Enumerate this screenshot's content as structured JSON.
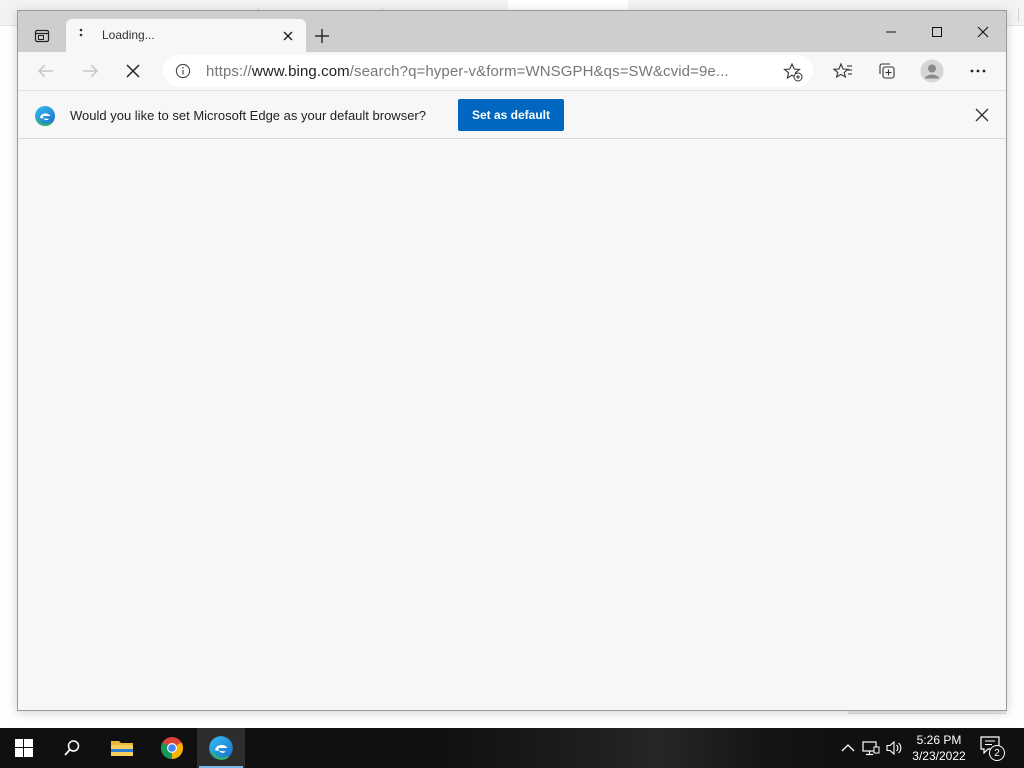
{
  "browser": {
    "tab": {
      "title": "Loading...",
      "state": "loading"
    },
    "address": {
      "scheme": "https://",
      "host": "www.bing.com",
      "path": "/search?q=hyper-v&form=WNSGPH&qs=SW&cvid=9e..."
    },
    "infobar": {
      "message": "Would you like to set Microsoft Edge as your default browser?",
      "button_label": "Set as default"
    },
    "icons": {
      "back": "back-arrow-icon",
      "forward": "forward-arrow-icon",
      "stop": "stop-loading-icon",
      "info": "site-info-icon",
      "add_favorite": "add-favorite-icon",
      "favorites": "favorites-icon",
      "collections": "collections-icon",
      "profile": "profile-icon",
      "menu": "more-options-icon"
    },
    "colors": {
      "accent": "#0067c0",
      "titlebar": "#cecece",
      "page": "#f7f7f7"
    }
  },
  "taskbar": {
    "time": "5:26 PM",
    "date": "3/23/2022",
    "notification_count": "2",
    "apps": [
      "start",
      "search",
      "file-explorer",
      "chrome",
      "edge"
    ]
  }
}
